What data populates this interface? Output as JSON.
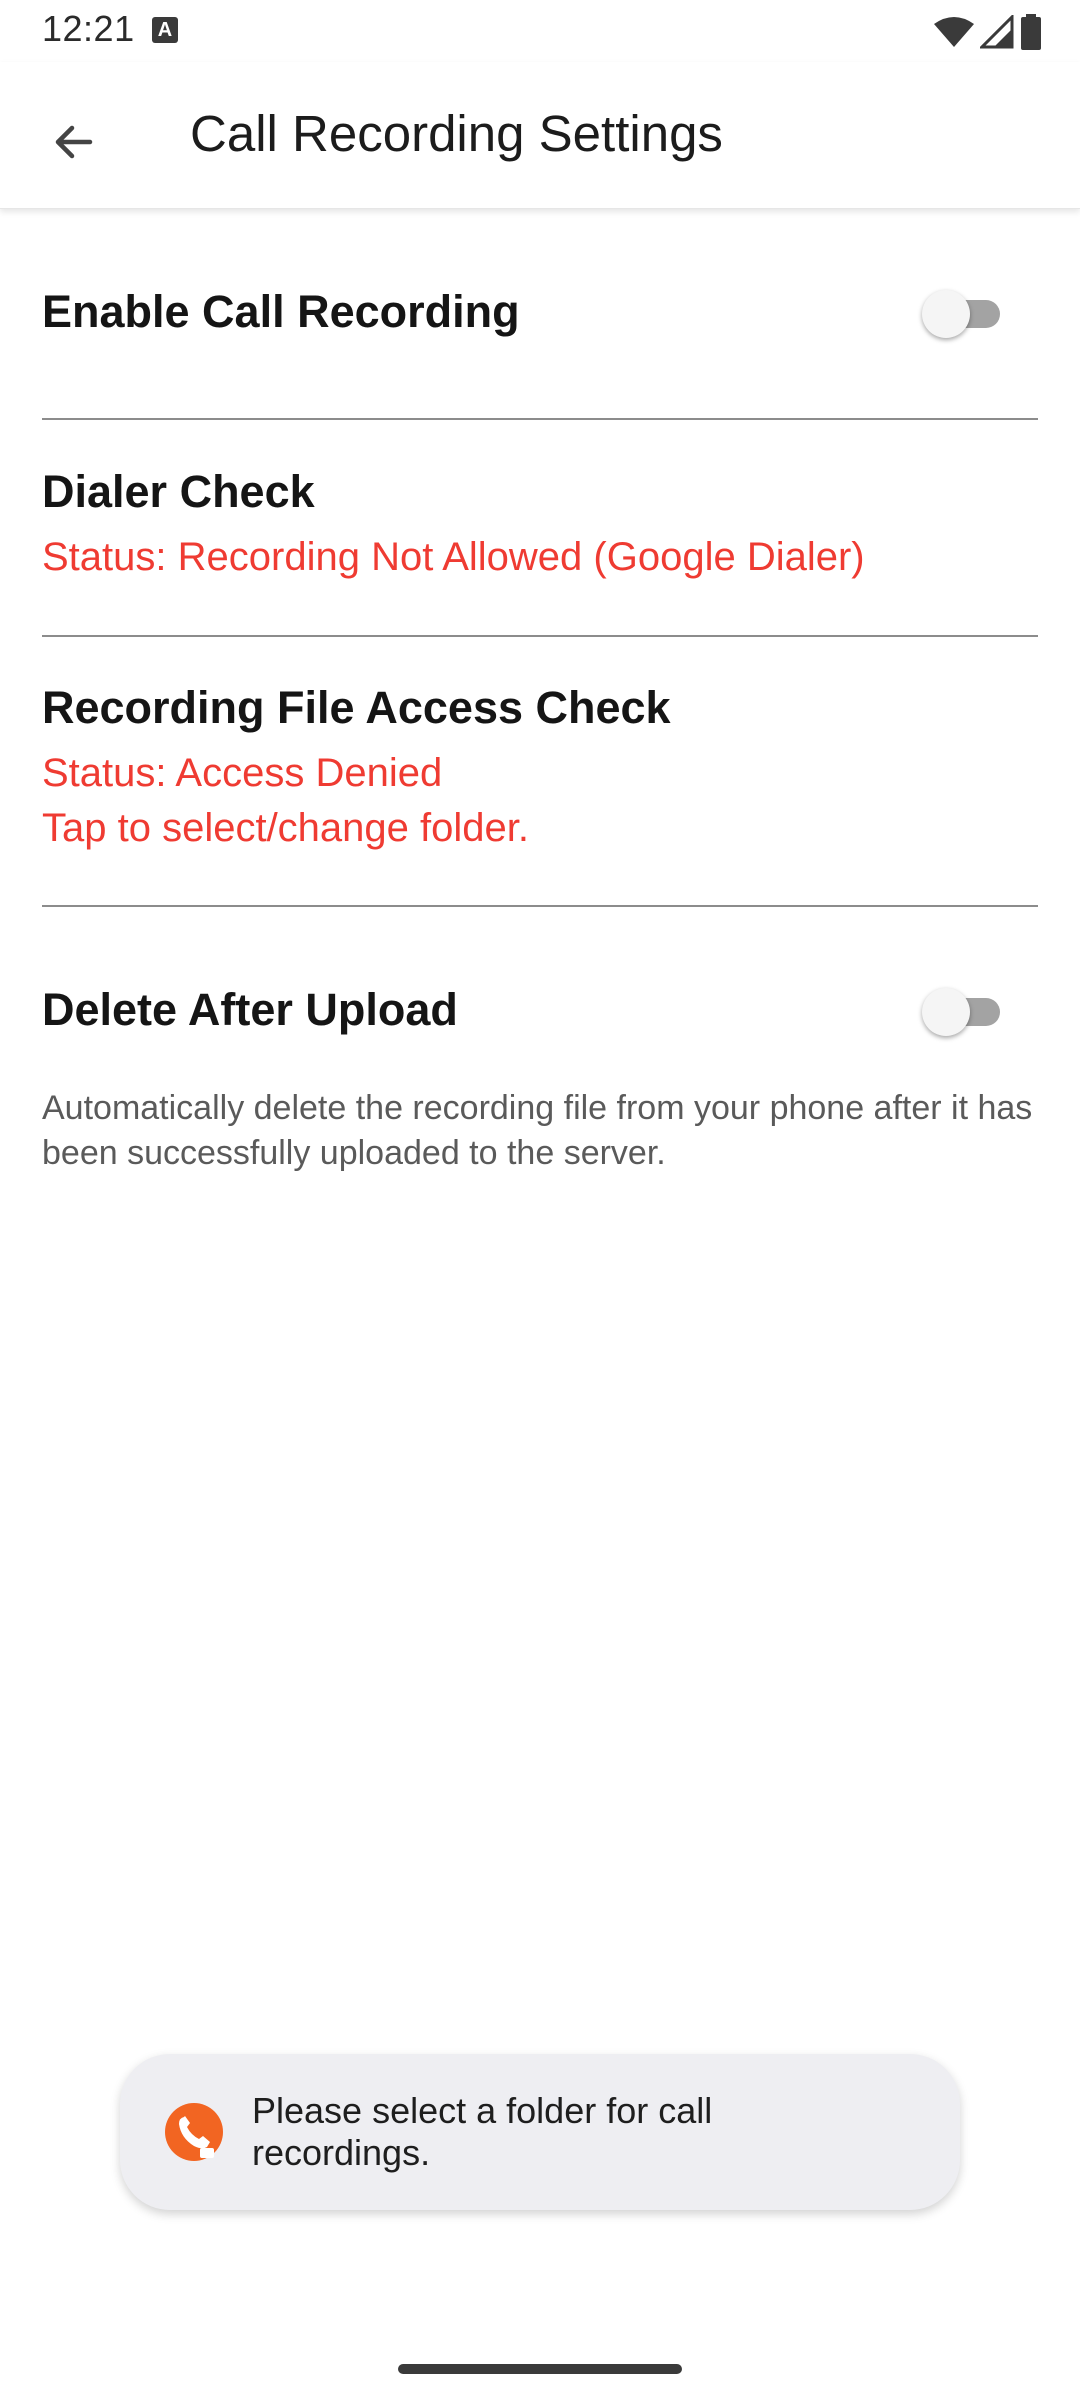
{
  "status_bar": {
    "time": "12:21",
    "notification_icon_letter": "A",
    "icons": [
      "wifi-icon",
      "cell-signal-icon",
      "battery-icon"
    ]
  },
  "app_bar": {
    "back_icon": "arrow-left-icon",
    "title": "Call Recording Settings"
  },
  "settings": {
    "enable_recording": {
      "title": "Enable Call Recording",
      "enabled": false
    },
    "dialer_check": {
      "title": "Dialer Check",
      "status": "Status: Recording Not Allowed (Google Dialer)"
    },
    "file_access_check": {
      "title": "Recording File Access Check",
      "status_line1": "Status: Access Denied",
      "status_line2": "Tap to select/change folder."
    },
    "delete_after_upload": {
      "title": "Delete After Upload",
      "enabled": false,
      "description": "Automatically delete the recording file from your phone after it has been successfully uploaded to the server."
    }
  },
  "toast": {
    "icon": "phone-app-icon",
    "message": "Please select a folder for call recordings."
  },
  "colors": {
    "error": "#ef3b32",
    "toggle_track_off": "#a3a3a3",
    "toggle_thumb_off": "#f5f5f5",
    "app_icon": "#f26522"
  }
}
